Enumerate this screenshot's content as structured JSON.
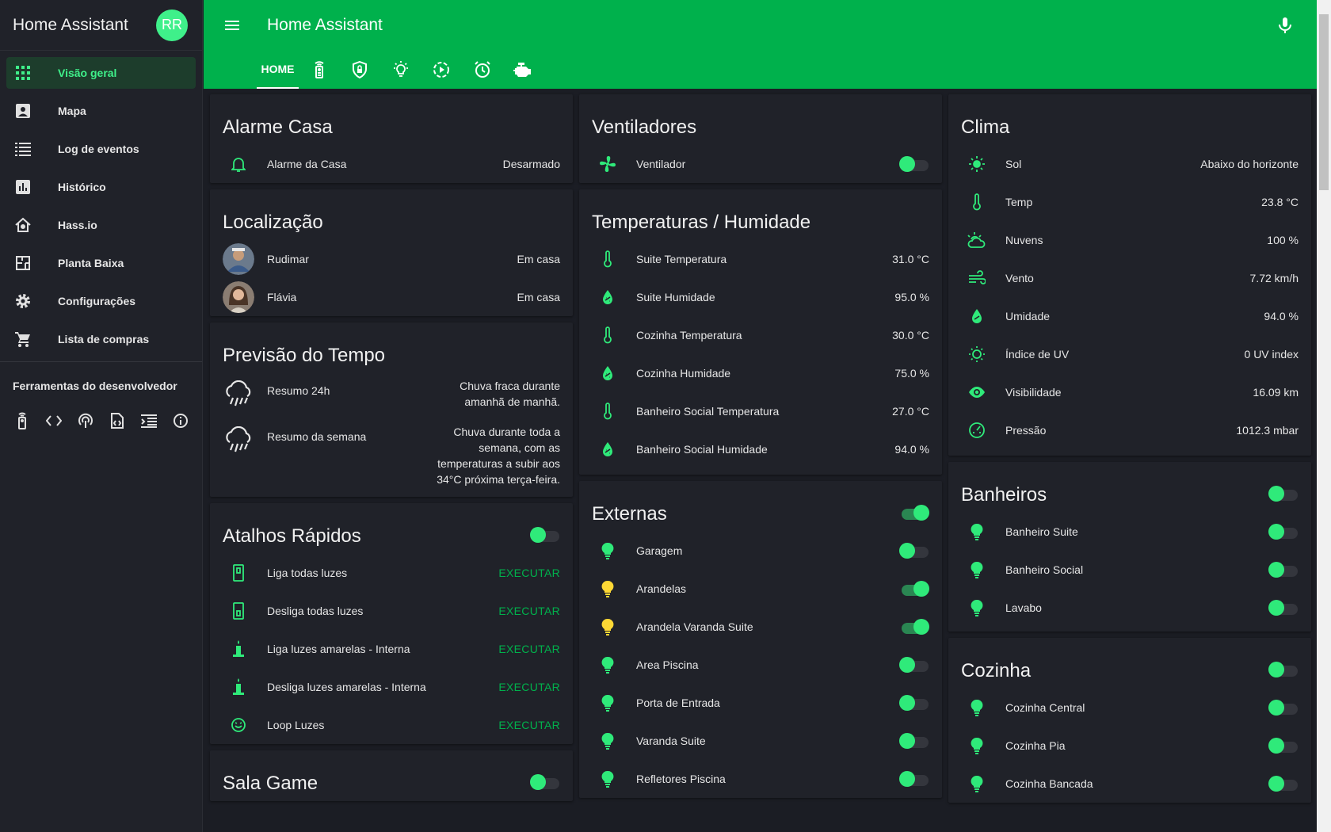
{
  "sidebar": {
    "title": "Home Assistant",
    "avatar_initials": "RR",
    "items": [
      {
        "label": "Visão geral",
        "icon": "grid-icon"
      },
      {
        "label": "Mapa",
        "icon": "map-icon"
      },
      {
        "label": "Log de eventos",
        "icon": "list-icon"
      },
      {
        "label": "Histórico",
        "icon": "chart-icon"
      },
      {
        "label": "Hass.io",
        "icon": "home-assistant-icon"
      },
      {
        "label": "Planta Baixa",
        "icon": "floorplan-icon"
      },
      {
        "label": "Configurações",
        "icon": "gear-icon"
      },
      {
        "label": "Lista de compras",
        "icon": "cart-icon"
      }
    ],
    "dev_title": "Ferramentas do desenvolvedor"
  },
  "header": {
    "title": "Home Assistant",
    "home_tab": "HOME"
  },
  "cards": {
    "alarme": {
      "title": "Alarme Casa",
      "rows": [
        {
          "name": "Alarme da Casa",
          "value": "Desarmado"
        }
      ]
    },
    "localizacao": {
      "title": "Localização",
      "rows": [
        {
          "name": "Rudimar",
          "value": "Em casa"
        },
        {
          "name": "Flávia",
          "value": "Em casa"
        }
      ]
    },
    "previsao": {
      "title": "Previsão do Tempo",
      "rows": [
        {
          "name": "Resumo 24h",
          "value": "Chuva fraca durante amanhã de manhã."
        },
        {
          "name": "Resumo da semana",
          "value": "Chuva durante toda a semana, com as temperaturas a subir aos 34°C próxima terça-feira."
        }
      ]
    },
    "atalhos": {
      "title": "Atalhos Rápidos",
      "action": "EXECUTAR",
      "rows": [
        {
          "name": "Liga todas luzes"
        },
        {
          "name": "Desliga todas luzes"
        },
        {
          "name": "Liga luzes amarelas - Interna"
        },
        {
          "name": "Desliga luzes amarelas - Interna"
        },
        {
          "name": "Loop Luzes"
        }
      ]
    },
    "salagame": {
      "title": "Sala Game"
    },
    "ventiladores": {
      "title": "Ventiladores",
      "rows": [
        {
          "name": "Ventilador",
          "on": false
        }
      ]
    },
    "temperaturas": {
      "title": "Temperaturas / Humidade",
      "rows": [
        {
          "name": "Suite Temperatura",
          "value": "31.0 °C",
          "type": "thermometer"
        },
        {
          "name": "Suite Humidade",
          "value": "95.0 %",
          "type": "water"
        },
        {
          "name": "Cozinha Temperatura",
          "value": "30.0 °C",
          "type": "thermometer"
        },
        {
          "name": "Cozinha Humidade",
          "value": "75.0 %",
          "type": "water"
        },
        {
          "name": "Banheiro Social Temperatura",
          "value": "27.0 °C",
          "type": "thermometer"
        },
        {
          "name": "Banheiro Social Humidade",
          "value": "94.0 %",
          "type": "water"
        }
      ]
    },
    "externas": {
      "title": "Externas",
      "rows": [
        {
          "name": "Garagem",
          "on": false
        },
        {
          "name": "Arandelas",
          "on": true
        },
        {
          "name": "Arandela Varanda Suite",
          "on": true
        },
        {
          "name": "Area Piscina",
          "on": false
        },
        {
          "name": "Porta de Entrada",
          "on": false
        },
        {
          "name": "Varanda Suite",
          "on": false
        },
        {
          "name": "Refletores Piscina",
          "on": false
        }
      ]
    },
    "clima": {
      "title": "Clima",
      "rows": [
        {
          "name": "Sol",
          "value": "Abaixo do horizonte",
          "icon": "sun-icon"
        },
        {
          "name": "Temp",
          "value": "23.8 °C",
          "icon": "thermometer-icon"
        },
        {
          "name": "Nuvens",
          "value": "100 %",
          "icon": "cloud-sun-icon"
        },
        {
          "name": "Vento",
          "value": "7.72 km/h",
          "icon": "wind-icon"
        },
        {
          "name": "Umidade",
          "value": "94.0 %",
          "icon": "water-icon"
        },
        {
          "name": "Índice de UV",
          "value": "0 UV index",
          "icon": "uv-icon"
        },
        {
          "name": "Visibilidade",
          "value": "16.09 km",
          "icon": "eye-icon"
        },
        {
          "name": "Pressão",
          "value": "1012.3 mbar",
          "icon": "gauge-icon"
        }
      ]
    },
    "banheiros": {
      "title": "Banheiros",
      "rows": [
        {
          "name": "Banheiro Suite",
          "on": false
        },
        {
          "name": "Banheiro Social",
          "on": false
        },
        {
          "name": "Lavabo",
          "on": false
        }
      ]
    },
    "cozinha": {
      "title": "Cozinha",
      "rows": [
        {
          "name": "Cozinha Central",
          "on": false
        },
        {
          "name": "Cozinha Pia",
          "on": false
        },
        {
          "name": "Cozinha Bancada",
          "on": false
        }
      ]
    }
  },
  "colors": {
    "accent": "#00b14c",
    "icon_green": "#2fea7a",
    "bulb_on": "#fdd835",
    "background": "#1b1d24",
    "card": "#202229"
  }
}
